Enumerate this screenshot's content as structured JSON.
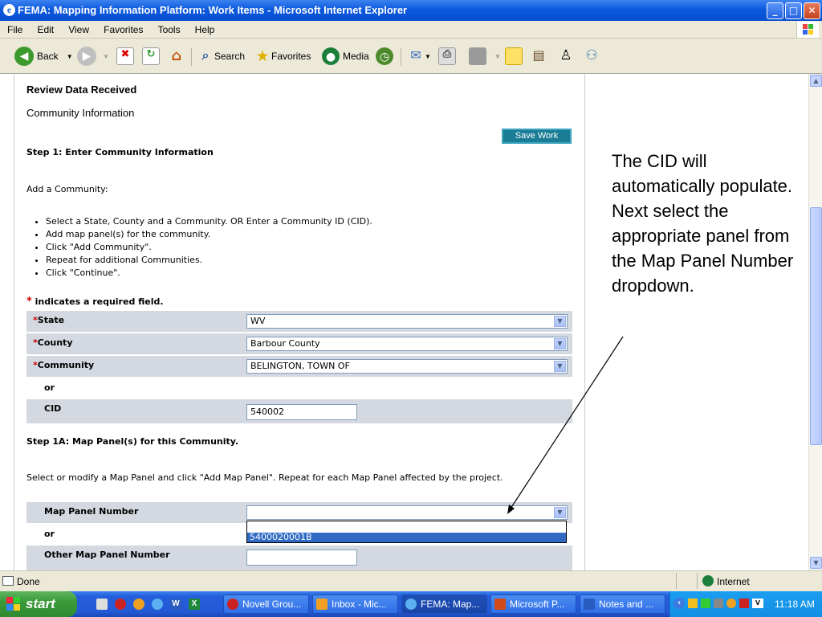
{
  "window": {
    "title": "FEMA: Mapping Information Platform: Work Items - Microsoft Internet Explorer",
    "minimize": "_",
    "maximize": "□",
    "close": "✕"
  },
  "menu": [
    "File",
    "Edit",
    "View",
    "Favorites",
    "Tools",
    "Help"
  ],
  "toolbar": {
    "back": "Back",
    "search": "Search",
    "favorites": "Favorites",
    "media": "Media"
  },
  "page": {
    "heading": "Review Data Received",
    "subheading": "Community Information",
    "save_button": "Save Work",
    "step1_title": "Step 1: Enter Community Information",
    "add_community": "Add a Community:",
    "instructions": [
      "Select a State, County and a Community. OR Enter a Community ID (CID).",
      "Add map panel(s) for the community.",
      "Click \"Add Community\".",
      "Repeat for additional Communities.",
      "Click \"Continue\"."
    ],
    "required_mark": "*",
    "required_note": "indicates a required field.",
    "fields": {
      "state_label": "State",
      "state_value": "WV",
      "county_label": "County",
      "county_value": "Barbour County",
      "community_label": "Community",
      "community_value": "BELINGTON, TOWN OF",
      "or1": "or",
      "cid_label": "CID",
      "cid_value": "540002"
    },
    "step1a_title": "Step 1A: Map Panel(s) for this Community.",
    "step1a_instructions": "Select or modify a Map Panel and click \"Add Map Panel\". Repeat for each Map Panel affected by the project.",
    "map_panel_label": "Map Panel Number",
    "map_panel_option": "5400020001B",
    "or2": "or",
    "other_map_panel_label": "Other Map Panel Number"
  },
  "callout": "The CID will automatically populate. Next select the appropriate panel from the Map Panel Number dropdown.",
  "status": {
    "text": "Done",
    "zone": "Internet"
  },
  "taskbar": {
    "start": "start",
    "tasks": [
      "Novell Grou...",
      "Inbox - Mic...",
      "FEMA: Map...",
      "Microsoft P...",
      "Notes and ..."
    ],
    "clock": "11:18 AM"
  },
  "colors": {
    "titlebar": "#0a58dd",
    "form_row": "#d4d8e0",
    "save_button": "#1a7d95",
    "selected_option": "#316ac5"
  }
}
